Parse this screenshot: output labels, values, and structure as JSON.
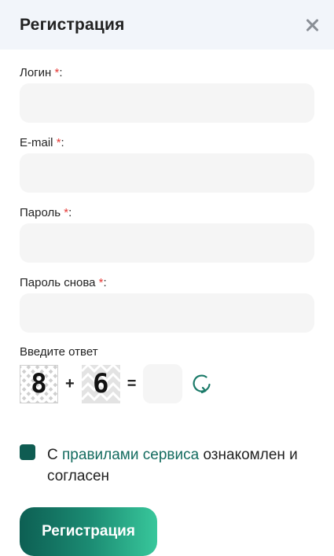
{
  "modal": {
    "title": "Регистрация"
  },
  "form": {
    "required_mark": "*",
    "login": {
      "label": "Логин",
      "value": ""
    },
    "email": {
      "label": "E-mail",
      "value": ""
    },
    "password": {
      "label": "Пароль",
      "value": ""
    },
    "password_repeat": {
      "label": "Пароль снова",
      "value": ""
    }
  },
  "captcha": {
    "label": "Введите ответ",
    "operand1": "8",
    "operator": "+",
    "operand2": "6",
    "equals": "=",
    "answer": ""
  },
  "agreement": {
    "prefix": "С",
    "link_text": "правилами сервиса",
    "suffix": "ознакомлен и согласен",
    "checked": true
  },
  "submit": {
    "label": "Регистрация"
  },
  "icons": {
    "close": "close-icon",
    "refresh": "refresh-icon"
  },
  "colors": {
    "header_bg": "#f2f5fa",
    "accent": "#0f5c52",
    "link": "#136b5f",
    "required": "#e53935",
    "input_bg": "#f5f5f5"
  }
}
